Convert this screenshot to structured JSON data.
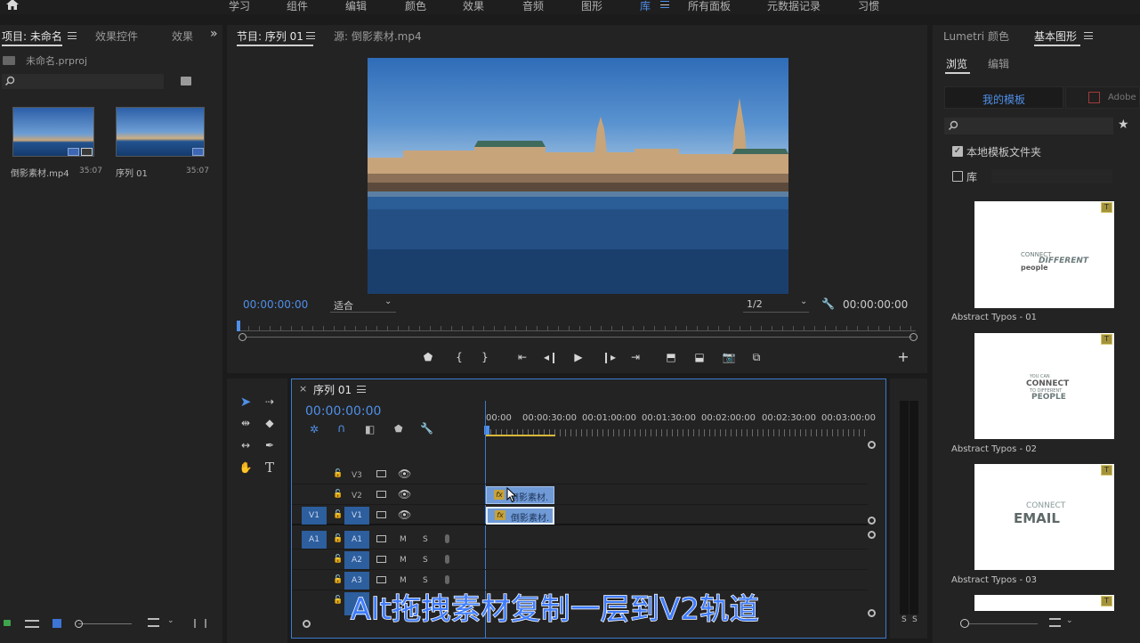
{
  "workspaces": [
    "学习",
    "组件",
    "编辑",
    "颜色",
    "效果",
    "音频",
    "图形",
    "库",
    "所有面板",
    "元数据记录",
    "习惯"
  ],
  "workspace_active": "库",
  "project_panel": {
    "tabs": [
      "项目: 未命名",
      "效果控件",
      "效果"
    ],
    "project_file": "未命名.prproj",
    "items": [
      {
        "name": "倒影素材.mp4",
        "duration": "35:07"
      },
      {
        "name": "序列 01",
        "duration": "35:07"
      }
    ]
  },
  "program_panel": {
    "tabs": [
      "节目: 序列 01",
      "源: 倒影素材.mp4"
    ],
    "timecode_left": "00:00:00:00",
    "fit": "适合",
    "resolution": "1/2",
    "timecode_right": "00:00:00:00"
  },
  "timeline": {
    "tab": "序列 01",
    "timecode": "00:00:00:00",
    "ruler": [
      "00:00",
      "00:00:30:00",
      "00:01:00:00",
      "00:01:30:00",
      "00:02:00:00",
      "00:02:30:00",
      "00:03:00:00"
    ],
    "video_tracks": [
      "V3",
      "V2",
      "V1"
    ],
    "audio_tracks": [
      "A1",
      "A2",
      "A3"
    ],
    "source_v": "V1",
    "source_a": "A1",
    "clip_v2": "倒影素材.",
    "clip_v1": "倒影素材.",
    "fx": "fx",
    "mute": "M",
    "solo": "S"
  },
  "meter": {
    "labels": [
      "S",
      "S"
    ]
  },
  "graphics_panel": {
    "tabs": [
      "Lumetri 颜色",
      "基本图形"
    ],
    "subtabs": [
      "浏览",
      "编辑"
    ],
    "my_templates": "我的模板",
    "adobe_stock": "Adobe",
    "local_folder": "本地模板文件夹",
    "library": "库",
    "templates": [
      {
        "name": "Abstract Typos - 01",
        "art": [
          "CONNECT",
          "DIFFERENT",
          "people"
        ]
      },
      {
        "name": "Abstract Typos - 02",
        "art": [
          "YOU CAN",
          "CONNECT",
          "TO DIFFERENT",
          "PEOPLE"
        ]
      },
      {
        "name": "Abstract Typos - 03",
        "art": [
          "CONNECT",
          "EMAIL"
        ]
      }
    ]
  },
  "subtitle": "Alt拖拽素材复制一层到V2轨道",
  "colors": {
    "accent_blue": "#4f8fe8",
    "clip_blue": "#6f9ad6",
    "subtitle_fill": "#3f7cff",
    "badge_gold": "#a2933b"
  }
}
